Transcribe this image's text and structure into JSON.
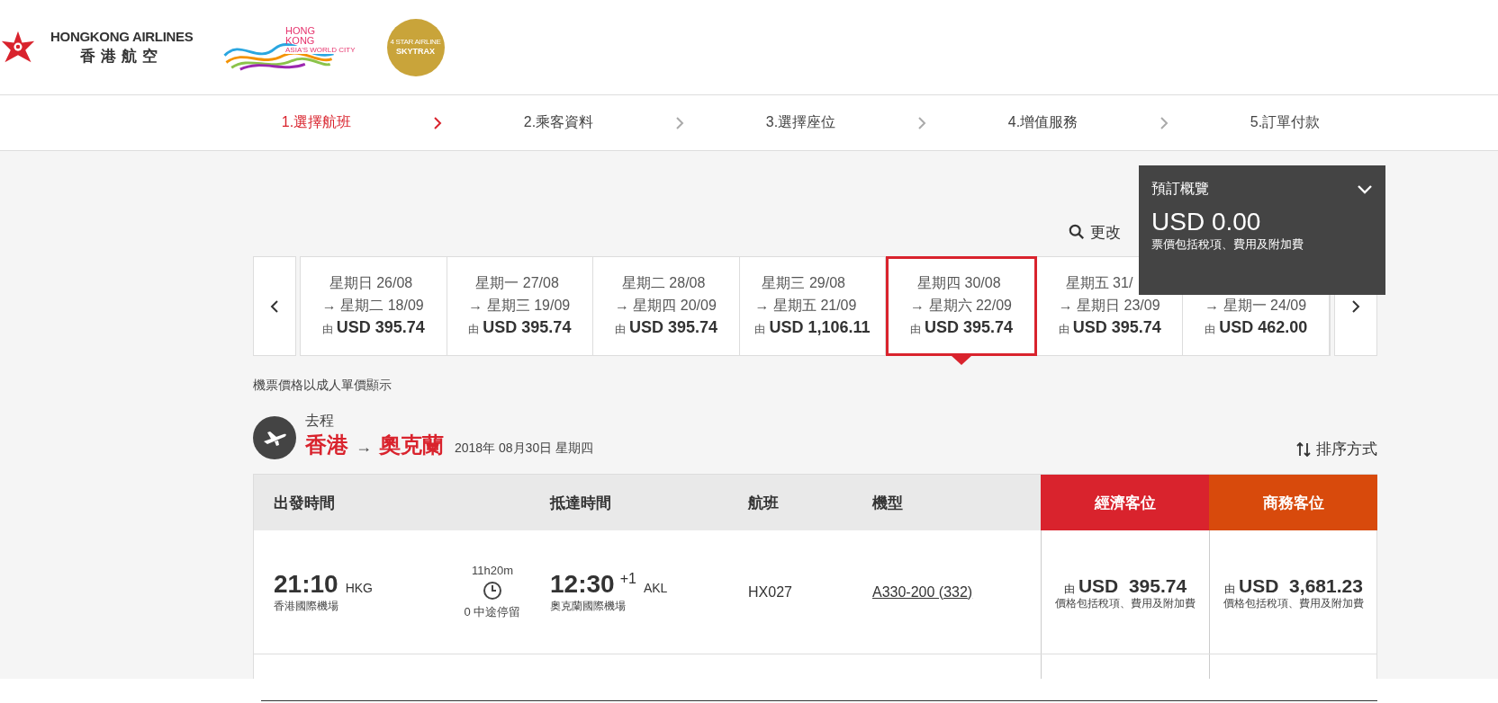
{
  "logos": {
    "airline_en": "HONGKONG AIRLINES",
    "airline_zh": "香港航空",
    "city_brand": [
      "HONG",
      "KONG"
    ],
    "city_tagline": "ASIA'S WORLD CITY",
    "badge_line": "4 STAR AIRLINE",
    "badge_name": "SKYTRAX"
  },
  "steps": [
    {
      "label": "1.選擇航班",
      "selected": true
    },
    {
      "label": "2.乘客資料",
      "selected": false
    },
    {
      "label": "3.選擇座位",
      "selected": false
    },
    {
      "label": "4.增值服務",
      "selected": false
    },
    {
      "label": "5.訂單付款",
      "selected": false
    }
  ],
  "search_link": "更改",
  "dates": [
    {
      "depart": "星期日 26/08",
      "return": "→ 星期二 18/09",
      "prefix": "由",
      "price": "USD 395.74",
      "selected": false
    },
    {
      "depart": "星期一 27/08",
      "return": "→ 星期三 19/09",
      "prefix": "由",
      "price": "USD 395.74",
      "selected": false
    },
    {
      "depart": "星期二 28/08",
      "return": "→ 星期四 20/09",
      "prefix": "由",
      "price": "USD 395.74",
      "selected": false
    },
    {
      "depart": "星期三 29/08",
      "return": "→ 星期五 21/09",
      "prefix": "由",
      "price": "USD 1,106.11",
      "selected": false
    },
    {
      "depart": "星期四 30/08",
      "return": "→ 星期六 22/09",
      "prefix": "由",
      "price": "USD 395.74",
      "selected": true
    },
    {
      "depart": "星期五 31/",
      "return": "→ 星期日 23/09",
      "prefix": "由",
      "price": "USD 395.74",
      "selected": false
    },
    {
      "return": "→ 星期一 24/09",
      "prefix": "由",
      "price": "USD 462.00",
      "selected": false
    }
  ],
  "note": "機票價格以成人單價顯示",
  "leg": {
    "label": "去程",
    "origin": "香港",
    "arrow": "→",
    "destination": "奧克蘭",
    "date": "2018年 08月30日 星期四"
  },
  "sort": "排序方式",
  "table": {
    "columns": [
      "出發時間",
      "抵達時間",
      "航班",
      "機型"
    ],
    "cabins": [
      {
        "label": "經濟客位",
        "color": "#d9232d"
      },
      {
        "label": "商務客位",
        "color": "#d84a0c"
      }
    ],
    "rows": [
      {
        "depart_time": "21:10",
        "depart_code": "HKG",
        "depart_airport": "香港國際機場",
        "duration": "11h20m",
        "stops": "0 中途停留",
        "arrive_time": "12:30",
        "day_offset": "+1",
        "arrive_code": "AKL",
        "arrive_airport": "奧克蘭國際機場",
        "flight": "HX027",
        "aircraft": "A330-200 (332)",
        "fares": [
          {
            "prefix": "由",
            "price": "USD  395.74",
            "note": "價格包括稅項、費用及附加費"
          },
          {
            "prefix": "由",
            "price": "USD  3,681.23",
            "note": "價格包括稅項、費用及附加費"
          }
        ]
      }
    ]
  },
  "summary": {
    "title": "預訂概覽",
    "total": "USD 0.00",
    "note": "票價包括稅項、費用及附加費"
  }
}
